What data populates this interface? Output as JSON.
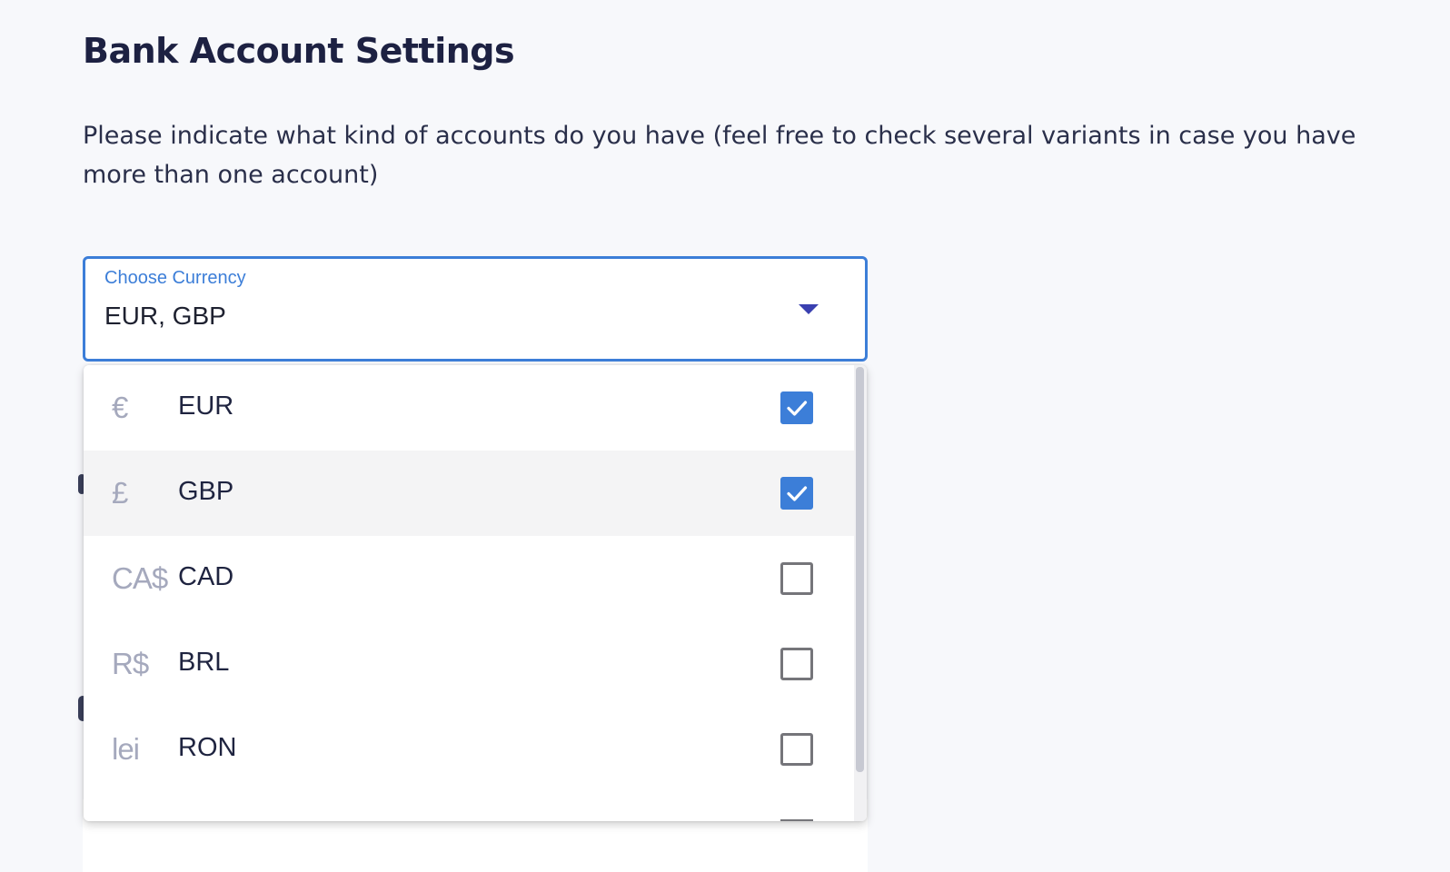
{
  "page": {
    "title": "Bank Account Settings",
    "description": "Please indicate what kind of accounts do you have (feel free to check several variants in case you have more than one account)"
  },
  "currency_select": {
    "label": "Choose Currency",
    "value": "EUR, GBP",
    "arrow_icon": "caret-down-icon",
    "accent_color": "#3c7ed8"
  },
  "options": [
    {
      "symbol": "€",
      "code": "EUR",
      "checked": true,
      "highlighted": false
    },
    {
      "symbol": "£",
      "code": "GBP",
      "checked": true,
      "highlighted": true
    },
    {
      "symbol": "CA$",
      "code": "CAD",
      "checked": false,
      "highlighted": false
    },
    {
      "symbol": "R$",
      "code": "BRL",
      "checked": false,
      "highlighted": false
    },
    {
      "symbol": "lei",
      "code": "RON",
      "checked": false,
      "highlighted": false
    }
  ]
}
